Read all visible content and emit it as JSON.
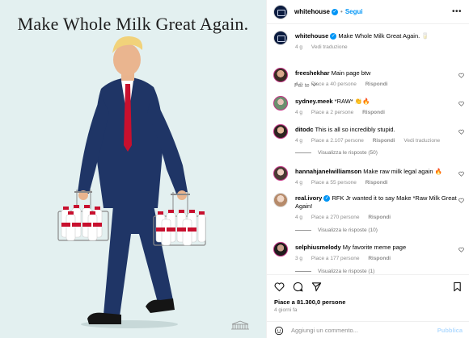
{
  "post": {
    "headline": "Make Whole Milk Great Again."
  },
  "header": {
    "username": "whitehouse",
    "separator": "•",
    "follow_label": "Segui",
    "more_icon": "more-horizontal-icon"
  },
  "caption": {
    "username": "whitehouse",
    "text": "Make Whole Milk Great Again. 🥛",
    "time": "4 g",
    "translate": "Vedi traduzione"
  },
  "see_translations": "Per te",
  "comments": [
    {
      "username": "freeshekhar",
      "text": "Main page btw",
      "time": "4 g",
      "likes": "Piace a 40 persone",
      "reply": "Rispondi"
    },
    {
      "username": "sydney.meek",
      "text": "*RAW* 👏🔥",
      "time": "4 g",
      "likes": "Piace a 2 persone",
      "reply": "Rispondi"
    },
    {
      "username": "ditodc",
      "text": "This is all so incredibly stupid.",
      "time": "4 g",
      "likes": "Piace a 2.107 persone",
      "reply": "Rispondi",
      "translate": "Vedi traduzione",
      "view_replies": "Visualizza le risposte (50)"
    },
    {
      "username": "hannahjanelwilliamson",
      "text": "Make raw milk legal again 🔥",
      "time": "4 g",
      "likes": "Piace a 55 persone",
      "reply": "Rispondi"
    },
    {
      "username": "real.ivory",
      "text": "RFK Jr wanted it to say Make *Raw Milk Great Again!",
      "time": "4 g",
      "likes": "Piace a 270 persone",
      "reply": "Rispondi",
      "view_replies": "Visualizza le risposte (10)"
    },
    {
      "username": "selphiusmelody",
      "text": "My favorite meme page",
      "time": "3 g",
      "likes": "Piace a 177 persone",
      "reply": "Rispondi",
      "view_replies": "Visualizza le risposte (1)"
    }
  ],
  "actions": {
    "likes": "Piace a 81.300,0 persone",
    "date": "4 giorni fa"
  },
  "composer": {
    "placeholder": "Aggiungi un commento...",
    "publish_label": "Pubblica"
  },
  "colors": {
    "accent": "#0095f6",
    "image_bg": "#e3f0f0",
    "suit": "#1f3566",
    "tie": "#c8102e"
  }
}
